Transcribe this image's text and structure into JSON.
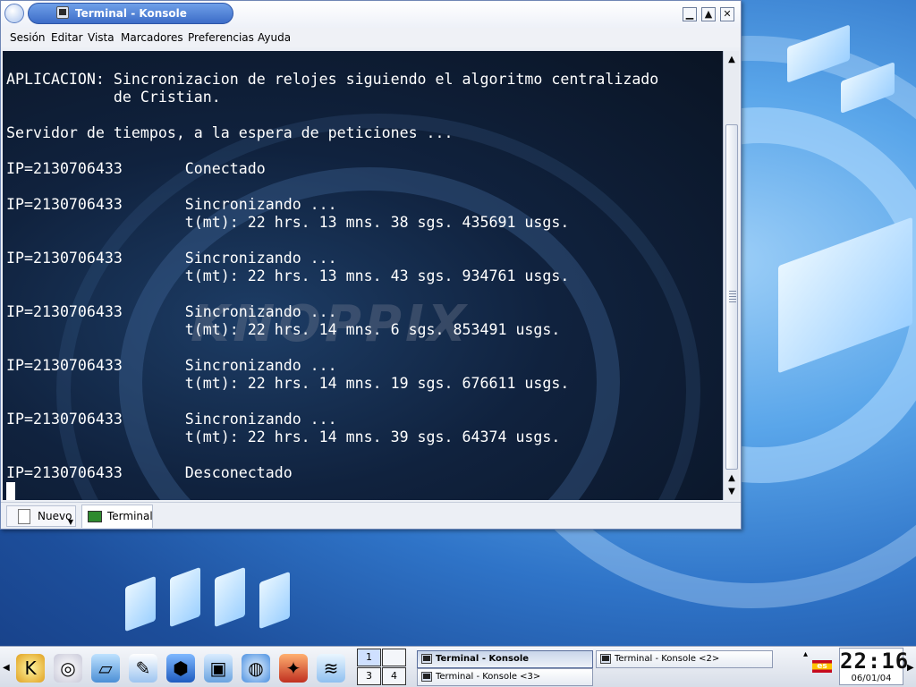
{
  "window": {
    "title": "Terminal - Konsole",
    "buttons": {
      "minimize": "▁",
      "maximize": "▲",
      "close": "✕"
    }
  },
  "menu": [
    "Sesión",
    "Editar",
    "Vista",
    "Marcadores",
    "Preferencias",
    "Ayuda"
  ],
  "terminal": {
    "watermark": "KNOPPIX",
    "lines": [
      "APLICACION: Sincronizacion de relojes siguiendo el algoritmo centralizado",
      "            de Cristian.",
      "",
      "Servidor de tiempos, a la espera de peticiones ...",
      "",
      "IP=2130706433       Conectado",
      "",
      "IP=2130706433       Sincronizando ...",
      "                    t(mt): 22 hrs. 13 mns. 38 sgs. 435691 usgs.",
      "",
      "IP=2130706433       Sincronizando ...",
      "                    t(mt): 22 hrs. 13 mns. 43 sgs. 934761 usgs.",
      "",
      "IP=2130706433       Sincronizando ...",
      "                    t(mt): 22 hrs. 14 mns. 6 sgs. 853491 usgs.",
      "",
      "IP=2130706433       Sincronizando ...",
      "                    t(mt): 22 hrs. 14 mns. 19 sgs. 676611 usgs.",
      "",
      "IP=2130706433       Sincronizando ...",
      "                    t(mt): 22 hrs. 14 mns. 39 sgs. 64374 usgs.",
      "",
      "IP=2130706433       Desconectado"
    ]
  },
  "scrollbar": {
    "up": "▲",
    "down": "▼"
  },
  "tabs": {
    "new_label": "Nuevo",
    "session_label": "Terminal"
  },
  "taskbar": {
    "launchers": [
      "kde-menu-icon",
      "help-icon",
      "home-icon",
      "control-center-icon",
      "cube-icon",
      "desktop-icon",
      "browser-icon",
      "terminal-icon",
      "office-icon"
    ],
    "pager": [
      "1",
      "",
      "3",
      "4"
    ],
    "tasks": [
      {
        "label": "Terminal - Konsole",
        "active": true
      },
      {
        "label": "Terminal - Konsole <2>",
        "active": false
      },
      {
        "label": "Terminal - Konsole <3>",
        "active": false
      }
    ],
    "keyboard_layout": "es",
    "clock_time": "22:16",
    "clock_date": "06/01/04"
  }
}
